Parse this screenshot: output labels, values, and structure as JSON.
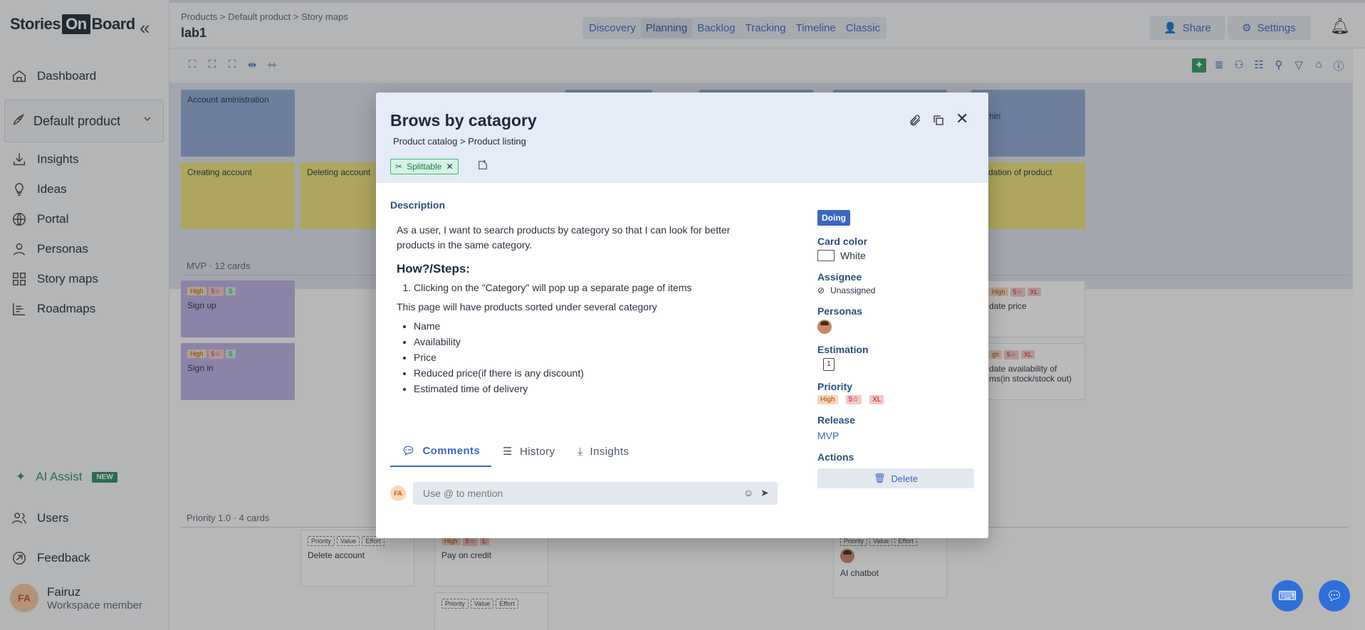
{
  "sidebar": {
    "logo_left": "Stories",
    "logo_on": "On",
    "logo_right": "Board",
    "collapse_icon": "«",
    "nav": [
      {
        "label": "Dashboard",
        "icon": "home-icon"
      },
      {
        "label": "Insights",
        "icon": "inbox-icon"
      },
      {
        "label": "Ideas",
        "icon": "lightbulb-icon"
      },
      {
        "label": "Portal",
        "icon": "globe-icon"
      },
      {
        "label": "Personas",
        "icon": "person-icon"
      },
      {
        "label": "Story maps",
        "icon": "grid-icon"
      },
      {
        "label": "Roadmaps",
        "icon": "roadmap-icon"
      }
    ],
    "product": "Default product",
    "ai_assist": "AI Assist",
    "new_badge": "NEW",
    "users": "Users",
    "feedback": "Feedback",
    "user": {
      "initials": "FA",
      "name": "Fairuz",
      "role": "Workspace member"
    }
  },
  "topbar": {
    "breadcrumb": "Products > Default product > Story maps",
    "title": "lab1",
    "views": [
      "Discovery",
      "Planning",
      "Backlog",
      "Tracking",
      "Timeline",
      "Classic"
    ],
    "active_view": "Planning",
    "share": "Share",
    "settings": "Settings"
  },
  "board": {
    "backbone": [
      "Account aministration",
      "min"
    ],
    "steps": [
      "Creating account",
      "Deleting account",
      "dation of product"
    ],
    "releases": [
      {
        "label": "MVP · 12 cards"
      },
      {
        "label": "Priority 1.0 · 4 cards"
      }
    ],
    "mvp_cards": [
      {
        "title": "Sign up",
        "tags": [
          "High",
          "5☆",
          "S"
        ]
      },
      {
        "title": "Sign in",
        "tags": [
          "High",
          "5☆",
          "S"
        ]
      },
      {
        "title": "date price",
        "tags": [
          "High",
          "5☆",
          "XL"
        ]
      },
      {
        "title": "date availability of ms(in stock/stock out)",
        "tags": [
          "gh",
          "5☆",
          "XL"
        ]
      }
    ],
    "p1_cards": [
      {
        "title": "Delete account",
        "tags": [
          "Priority",
          "Value",
          "Effort"
        ]
      },
      {
        "title": "Pay on credit",
        "tags": [
          "High",
          "5☆",
          "L"
        ]
      },
      {
        "title": "AI chatbot",
        "tags": [
          "Priority",
          "Value",
          "Effort"
        ]
      },
      {
        "title": "",
        "tags": [
          "Priority",
          "Value",
          "Effort"
        ]
      }
    ]
  },
  "modal": {
    "title": "Brows by catagory",
    "path": "Product catalog > Product listing",
    "chip": "Splittable",
    "description_label": "Description",
    "description_text": "As a user, I want to search products by category so that I can look for better products in the same category.",
    "how_heading": "How?/Steps:",
    "steps": [
      "Clicking on the \"Category\" will pop up a separate page of items"
    ],
    "mid_text": "This page will have products sorted under several category",
    "bullets": [
      "Name",
      "Availability",
      "Price",
      "Reduced price(if there is any discount)",
      "Estimated time of delivery"
    ],
    "tabs": [
      "Comments",
      "History",
      "Insights"
    ],
    "active_tab": "Comments",
    "comment_placeholder": "Use @ to mention",
    "comment_avatar": "FA",
    "status": "Doing",
    "card_color_label": "Card color",
    "card_color": "White",
    "assignee_label": "Assignee",
    "assignee": "Unassigned",
    "personas_label": "Personas",
    "estimation_label": "Estimation",
    "estimation": "1",
    "priority_label": "Priority",
    "priority_tags": [
      "High",
      "5☆",
      "XL"
    ],
    "release_label": "Release",
    "release": "MVP",
    "actions_label": "Actions",
    "delete": "Delete"
  }
}
